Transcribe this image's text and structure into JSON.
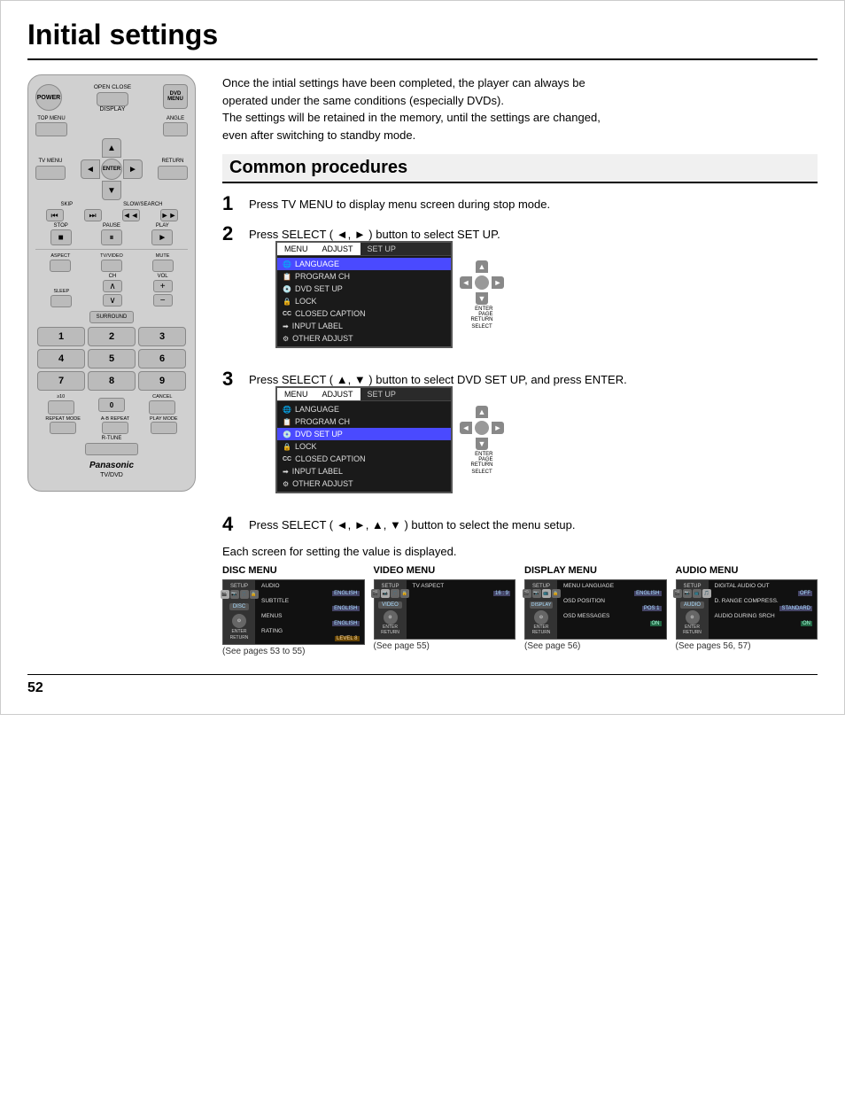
{
  "page": {
    "title": "Initial settings",
    "number": "52"
  },
  "intro": {
    "line1": "Once the intial settings have been completed, the player can always be",
    "line2": "operated under the same conditions (especially DVDs).",
    "line3": "The settings will be retained in the memory, until the settings are changed,",
    "line4": "even after switching to standby mode."
  },
  "section": {
    "title": "Common procedures"
  },
  "steps": [
    {
      "number": "1",
      "text": "Press TV MENU to display menu screen during stop mode."
    },
    {
      "number": "2",
      "text": "Press SELECT ( ◄, ► ) button to select SET UP."
    },
    {
      "number": "3",
      "text": "Press SELECT ( ▲, ▼ ) button to select DVD SET UP, and press ENTER."
    },
    {
      "number": "4",
      "text": "Press SELECT ( ◄, ►, ▲, ▼ ) button to select the menu setup."
    }
  ],
  "step4_sub": "Each screen for setting the value is displayed.",
  "menu1": {
    "header_adjust": "ADJUST",
    "header_setup": "SET UP",
    "items": [
      {
        "icon": "🌐",
        "label": "LANGUAGE",
        "highlighted": true
      },
      {
        "icon": "📻",
        "label": "PROGRAM CH",
        "highlighted": false
      },
      {
        "icon": "💿",
        "label": "DVD SET UP",
        "highlighted": false
      },
      {
        "icon": "🔒",
        "label": "LOCK",
        "highlighted": false
      },
      {
        "icon": "CC",
        "label": "CLOSED CAPTION",
        "highlighted": false
      },
      {
        "icon": "→",
        "label": "INPUT LABEL",
        "highlighted": false
      },
      {
        "icon": "⚙",
        "label": "OTHER ADJUST",
        "highlighted": false
      }
    ]
  },
  "menu2": {
    "header_adjust": "ADJUST",
    "header_setup": "SET UP",
    "items": [
      {
        "icon": "🌐",
        "label": "LANGUAGE",
        "highlighted": false
      },
      {
        "icon": "📻",
        "label": "PROGRAM CH",
        "highlighted": false
      },
      {
        "icon": "💿",
        "label": "DVD SET UP",
        "highlighted": true
      },
      {
        "icon": "🔒",
        "label": "LOCK",
        "highlighted": false
      },
      {
        "icon": "CC",
        "label": "CLOSED CAPTION",
        "highlighted": false
      },
      {
        "icon": "→",
        "label": "INPUT LABEL",
        "highlighted": false
      },
      {
        "icon": "⚙",
        "label": "OTHER ADJUST",
        "highlighted": false
      }
    ]
  },
  "bottom_menus": [
    {
      "title": "DISC MENU",
      "section_label": "DISC",
      "rows": [
        {
          "label": "AUDIO",
          "value": "ENGLISH",
          "valueClass": "blue"
        },
        {
          "label": "SUBTITLE",
          "value": "ENGLISH",
          "valueClass": "blue"
        },
        {
          "label": "MENUS",
          "value": "ENGLISH",
          "valueClass": "blue"
        },
        {
          "label": "RATING",
          "value": "LEVEL 8",
          "valueClass": "orange"
        }
      ],
      "see_pages": "(See pages 53 to 55)"
    },
    {
      "title": "VIDEO MENU",
      "section_label": "VIDEO",
      "rows": [
        {
          "label": "TV ASPECT",
          "value": "16 : 9",
          "valueClass": "blue"
        }
      ],
      "see_pages": "(See page 55)"
    },
    {
      "title": "DISPLAY MENU",
      "section_label": "DISPLAY",
      "rows": [
        {
          "label": "MENU LANGUAGE",
          "value": "ENGLISH",
          "valueClass": "blue"
        },
        {
          "label": "OSD POSITION",
          "value": "POS 1",
          "valueClass": "blue"
        },
        {
          "label": "OSD MESSAGES",
          "value": "ON",
          "valueClass": "green"
        }
      ],
      "see_pages": "(See page 56)"
    },
    {
      "title": "AUDIO MENU",
      "section_label": "AUDIO",
      "rows": [
        {
          "label": "DIGITAL AUDIO OUT",
          "value": "OFF",
          "valueClass": "blue"
        },
        {
          "label": "D. RANGE COMPRESS.",
          "value": "STANDARD",
          "valueClass": "blue"
        },
        {
          "label": "AUDIO DURING SRCH",
          "value": "ON",
          "valueClass": "green"
        }
      ],
      "see_pages": "(See pages 56, 57)"
    }
  ],
  "remote": {
    "power_label": "POWER",
    "open_close": "OPEN CLOSE",
    "display": "DISPLAY",
    "top_menu": "TOP MENU",
    "angle": "ANGLE",
    "dvd_menu": "DVD MENU",
    "tv_menu": "TV MENU",
    "return": "RETURN",
    "enter": "ENTER",
    "stop": "STOP",
    "pause": "PAUSE",
    "play": "PLAY",
    "skip": "SKIP",
    "slow_search": "SLOW/SEARCH",
    "aspect": "ASPECT",
    "tv_video": "TV/VIDEO",
    "mute": "MUTE",
    "sleep": "SLEEP",
    "ch": "CH",
    "vol": "VOL",
    "surround": "SURROUND",
    "cancel": "CANCEL",
    "ge10": "≥10",
    "repeat_mode": "REPEAT MODE",
    "ab_repeat": "A-B REPEAT",
    "play_mode": "PLAY MODE",
    "r_tune": "R-TUNE",
    "brand": "Panasonic",
    "brand_sub": "TV/DVD"
  },
  "nav_labels": {
    "enter": "ENTER",
    "page": "PAGE",
    "return": "RETURN",
    "select": "SELECT"
  }
}
